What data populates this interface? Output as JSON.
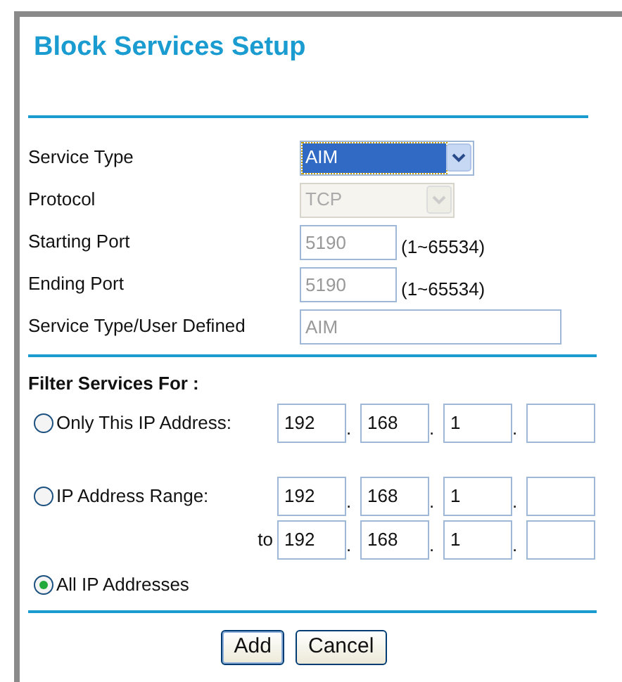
{
  "title": "Block Services Setup",
  "service_fields": [
    {
      "kind": "select",
      "label": "Service Type",
      "value": "AIM",
      "disabled": false,
      "focused": true
    },
    {
      "kind": "select",
      "label": "Protocol",
      "value": "TCP",
      "disabled": true,
      "focused": false
    },
    {
      "kind": "port",
      "label": "Starting Port",
      "value": "5190",
      "range": "(1~65534)",
      "disabled": true
    },
    {
      "kind": "port",
      "label": "Ending Port",
      "value": "5190",
      "range": "(1~65534)",
      "disabled": true
    },
    {
      "kind": "text",
      "label": "Service Type/User Defined",
      "value": "AIM",
      "disabled": true
    }
  ],
  "filter": {
    "heading": "Filter Services For :",
    "options": [
      {
        "kind": "single",
        "label": "Only This IP Address:",
        "selected": false,
        "separators": [
          ".",
          ".",
          "."
        ],
        "octets": [
          "192",
          "168",
          "1"
        ]
      },
      {
        "kind": "range",
        "label": "IP Address Range:",
        "selected": false,
        "separators": [
          ".",
          ".",
          "."
        ],
        "octets": [
          "192",
          "168",
          "1"
        ],
        "to_label": "to",
        "to_separators": [
          ".",
          ".",
          "."
        ],
        "to_octets": [
          "192",
          "168",
          "1"
        ]
      },
      {
        "kind": "all",
        "label": "All IP Addresses",
        "selected": true
      }
    ]
  },
  "buttons": [
    {
      "label": "Add",
      "default": true
    },
    {
      "label": "Cancel",
      "default": false
    }
  ]
}
